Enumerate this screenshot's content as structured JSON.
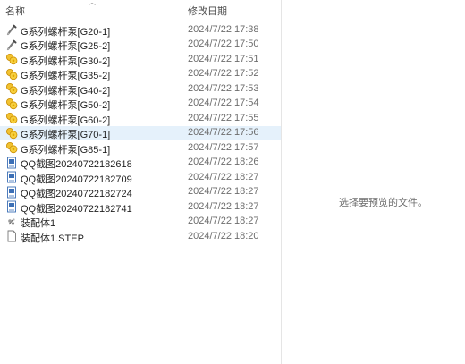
{
  "columns": {
    "name": "名称",
    "modified": "修改日期"
  },
  "files": [
    {
      "name": "G系列螺杆泵[G20-1]",
      "modified": "2024/7/22 17:38",
      "icon": "part-file-icon",
      "selected": false
    },
    {
      "name": "G系列螺杆泵[G25-2]",
      "modified": "2024/7/22 17:50",
      "icon": "part-file-icon",
      "selected": false
    },
    {
      "name": "G系列螺杆泵[G30-2]",
      "modified": "2024/7/22 17:51",
      "icon": "assembly-file-icon",
      "selected": false
    },
    {
      "name": "G系列螺杆泵[G35-2]",
      "modified": "2024/7/22 17:52",
      "icon": "assembly-file-icon",
      "selected": false
    },
    {
      "name": "G系列螺杆泵[G40-2]",
      "modified": "2024/7/22 17:53",
      "icon": "assembly-file-icon",
      "selected": false
    },
    {
      "name": "G系列螺杆泵[G50-2]",
      "modified": "2024/7/22 17:54",
      "icon": "assembly-file-icon",
      "selected": false
    },
    {
      "name": "G系列螺杆泵[G60-2]",
      "modified": "2024/7/22 17:55",
      "icon": "assembly-file-icon",
      "selected": false
    },
    {
      "name": "G系列螺杆泵[G70-1]",
      "modified": "2024/7/22 17:56",
      "icon": "assembly-file-icon",
      "selected": true
    },
    {
      "name": "G系列螺杆泵[G85-1]",
      "modified": "2024/7/22 17:57",
      "icon": "assembly-file-icon",
      "selected": false
    },
    {
      "name": "QQ截图20240722182618",
      "modified": "2024/7/22 18:26",
      "icon": "image-file-icon",
      "selected": false
    },
    {
      "name": "QQ截图20240722182709",
      "modified": "2024/7/22 18:27",
      "icon": "image-file-icon",
      "selected": false
    },
    {
      "name": "QQ截图20240722182724",
      "modified": "2024/7/22 18:27",
      "icon": "image-file-icon",
      "selected": false
    },
    {
      "name": "QQ截图20240722182741",
      "modified": "2024/7/22 18:27",
      "icon": "image-file-icon",
      "selected": false
    },
    {
      "name": "装配体1",
      "modified": "2024/7/22 18:27",
      "icon": "assembly-doc-icon",
      "selected": false
    },
    {
      "name": "装配体1.STEP",
      "modified": "2024/7/22 18:20",
      "icon": "blank-file-icon",
      "selected": false
    }
  ],
  "preview": {
    "message": "选择要预览的文件。"
  },
  "colors": {
    "selected_row": "#e5f1fb",
    "divider": "#e5e5e5",
    "date_text": "#6d6d6d"
  }
}
